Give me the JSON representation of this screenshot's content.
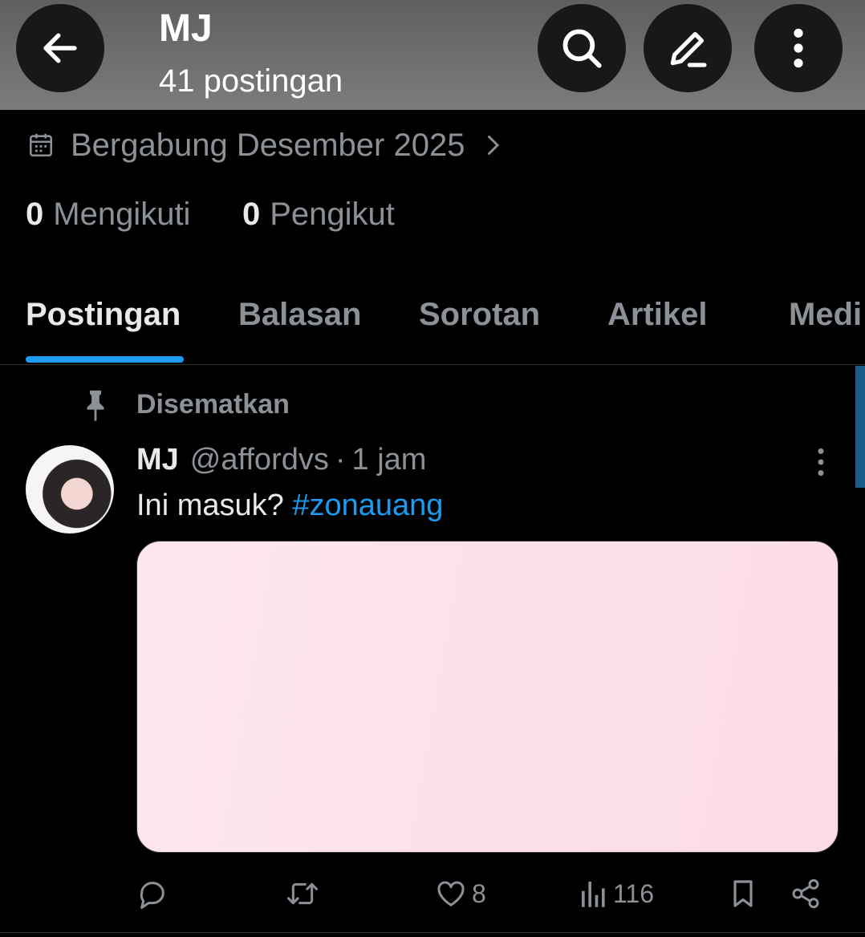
{
  "header": {
    "title": "MJ",
    "post_count": "41 postingan"
  },
  "profile": {
    "joined": "Bergabung Desember 2025",
    "following_count": "0",
    "following_label": "Mengikuti",
    "followers_count": "0",
    "followers_label": "Pengikut"
  },
  "tabs": [
    {
      "label": "Postingan",
      "active": true
    },
    {
      "label": "Balasan",
      "active": false
    },
    {
      "label": "Sorotan",
      "active": false
    },
    {
      "label": "Artikel",
      "active": false
    },
    {
      "label": "Medi",
      "active": false
    }
  ],
  "pinned": {
    "label": "Disematkan"
  },
  "post": {
    "name": "MJ",
    "handle": "@affordvs",
    "separator": "·",
    "time": "1 jam",
    "text": "Ini masuk?",
    "hashtag": "#zonauang",
    "likes": "8",
    "views": "116"
  },
  "colors": {
    "accent": "#1d9bf0",
    "secondary_text": "#8b9197",
    "background": "#000000"
  }
}
